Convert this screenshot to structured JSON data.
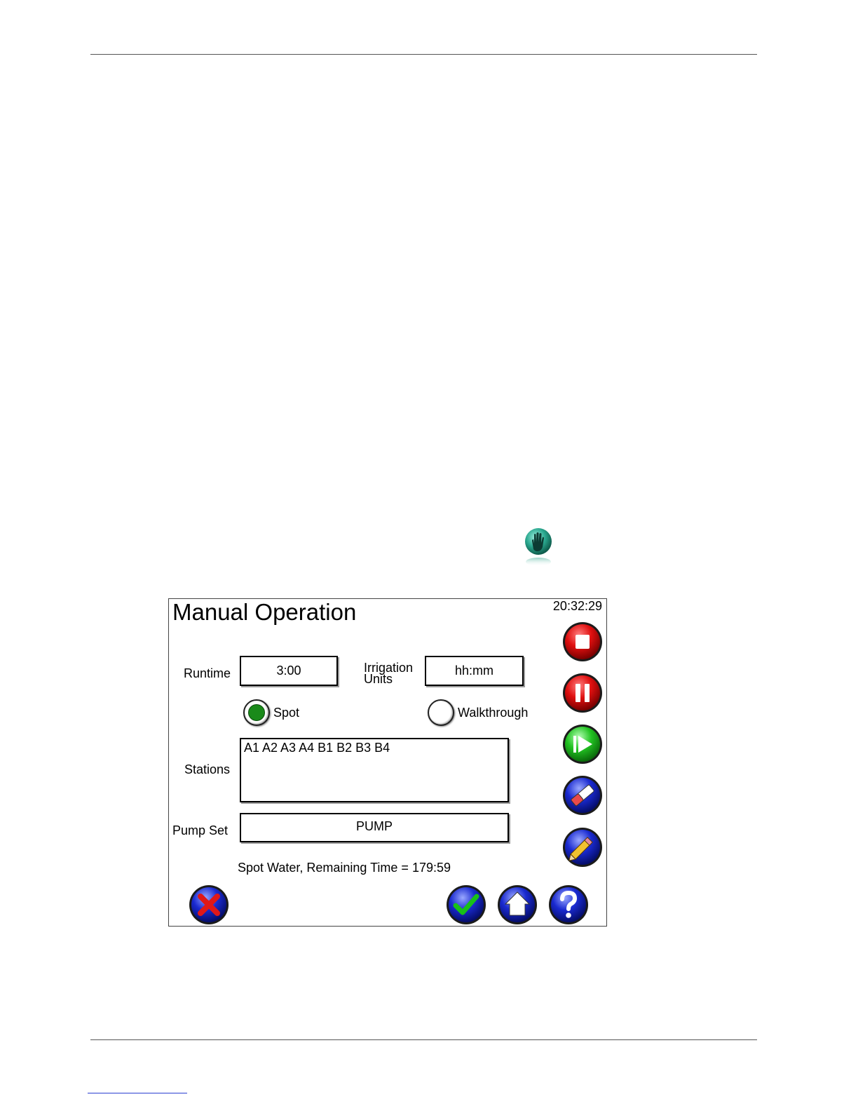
{
  "screen": {
    "title": "Manual Operation",
    "clock": "20:32:29",
    "runtime": {
      "label": "Runtime",
      "value": "3:00"
    },
    "irrigation_units": {
      "label_line1": "Irrigation",
      "label_line2": "Units",
      "value": "hh:mm"
    },
    "mode": {
      "spot": {
        "label": "Spot",
        "selected": true
      },
      "walkthrough": {
        "label": "Walkthrough",
        "selected": false
      }
    },
    "stations": {
      "label": "Stations",
      "value": "A1 A2 A3 A4 B1 B2 B3 B4"
    },
    "pump_set": {
      "label": "Pump Set",
      "value": "PUMP"
    },
    "status": "Spot Water, Remaining Time = 179:59"
  },
  "icons": {
    "manual": "hand-icon",
    "stop": "stop-icon",
    "pause": "pause-icon",
    "resume": "play-icon",
    "erase": "eraser-icon",
    "edit": "pencil-icon",
    "cancel": "x-icon",
    "accept": "checkmark-icon",
    "home": "home-icon",
    "help": "question-icon"
  },
  "colors": {
    "stop": "#e01010",
    "pause": "#e01010",
    "resume": "#22c322",
    "blue": "#1a2ad0",
    "spot_dot": "#1a8a1a",
    "cancel_x": "#e01818",
    "accept_check": "#18c018"
  }
}
